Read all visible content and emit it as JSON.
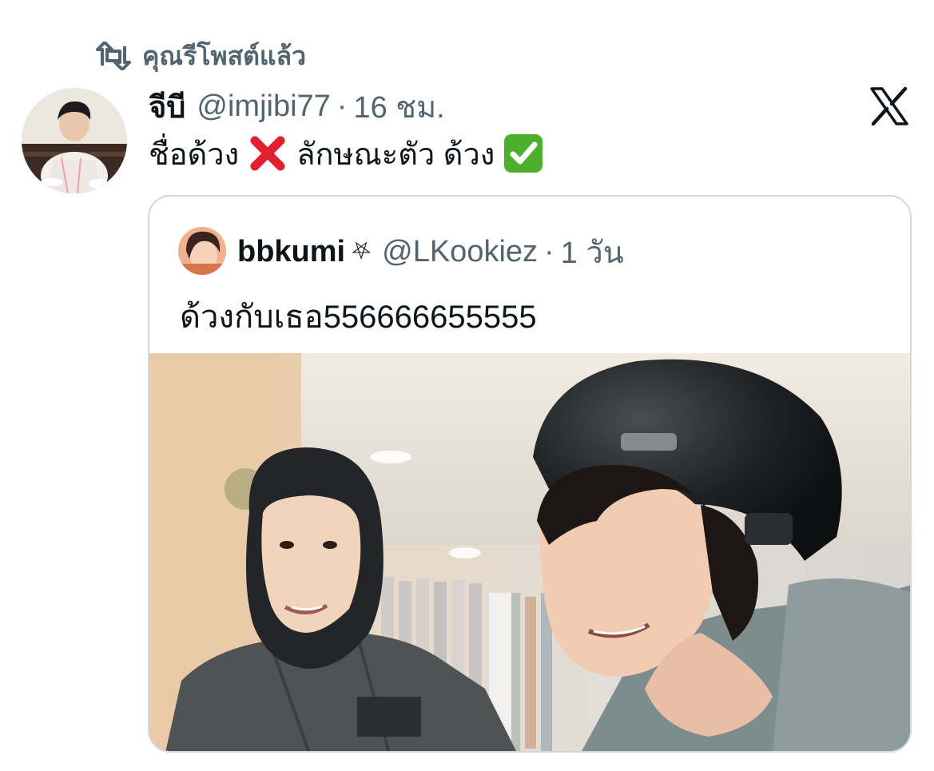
{
  "retweet": {
    "icon": "retweet-icon",
    "label": "คุณรีโพสต์แล้ว"
  },
  "tweet": {
    "avatar": "avatar",
    "display_name": "จีบี",
    "handle": "@imjibi77",
    "separator": "·",
    "time": "16 ชม.",
    "text_part1": "ชื่อด้วง",
    "text_emoji1": "cross-mark-emoji",
    "text_part2": "ลักษณะตัว ด้วง",
    "text_emoji2": "check-mark-button-emoji",
    "platform_icon": "x-logo-icon"
  },
  "quote": {
    "display_name": "bbkumi",
    "badge": "⛧",
    "handle": "@LKookiez",
    "separator": "·",
    "time": "1 วัน",
    "text": "ด้วงกับเธอ556666655555",
    "media": "photo-two-people-ski-gear"
  },
  "colors": {
    "text_primary": "#0f1419",
    "text_secondary": "#536471",
    "border": "#cfd9de",
    "cross_red": "#e0202f",
    "check_green": "#4caf2e"
  }
}
